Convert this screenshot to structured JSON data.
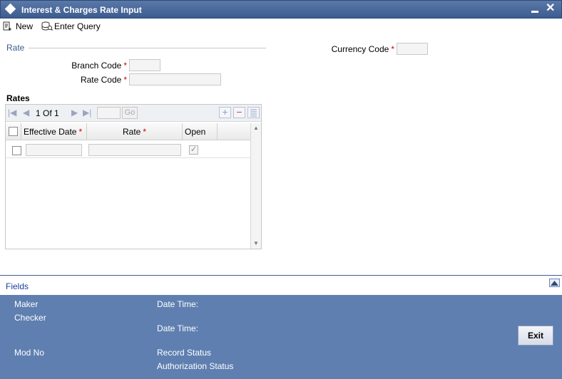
{
  "window": {
    "title": "Interest & Charges Rate Input",
    "icons": [
      "diamond-icon",
      "minimize-icon",
      "close-icon"
    ]
  },
  "toolbar": {
    "new_label": "New",
    "enter_query_label": "Enter Query"
  },
  "rate_section": {
    "legend": "Rate",
    "branch_code_label": "Branch Code",
    "rate_code_label": "Rate Code",
    "currency_code_label": "Currency Code",
    "required_marker": "*"
  },
  "rates_grid": {
    "title": "Rates",
    "page_current": "1",
    "page_of": "Of",
    "page_total": "1",
    "go_label": "Go",
    "columns": [
      "Effective Date",
      "Rate",
      "Open"
    ],
    "rows": [
      {
        "effective_date": "",
        "rate": "",
        "open": true
      }
    ]
  },
  "fields_bar": {
    "label": "Fields"
  },
  "footer": {
    "maker_label": "Maker",
    "checker_label": "Checker",
    "date_time_label_1": "Date Time:",
    "date_time_label_2": "Date Time:",
    "mod_no_label": "Mod No",
    "record_status_label": "Record Status",
    "authorization_status_label": "Authorization Status",
    "exit_label": "Exit"
  },
  "colors": {
    "title_bar": "#4a6a9c",
    "footer": "#5f7fb0",
    "legend_text": "#3d5c8f",
    "required": "#cc0000",
    "fields_link": "#1c3fa0"
  }
}
